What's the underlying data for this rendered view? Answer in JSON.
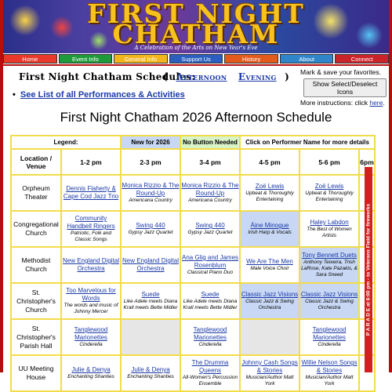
{
  "header": {
    "title_line1": "FIRST NIGHT",
    "title_line2": "CHATHAM",
    "tagline": "A Celebration of the Arts on New Year's Eve"
  },
  "nav": {
    "items": [
      {
        "label": "Home",
        "color": "#e8392b"
      },
      {
        "label": "Event Info",
        "color": "#1f9a3a"
      },
      {
        "label": "General Info",
        "color": "#f3b51c"
      },
      {
        "label": "Support Us",
        "color": "#2a5fbf"
      },
      {
        "label": "History",
        "color": "#e25a1c"
      },
      {
        "label": "About",
        "color": "#2f86c9"
      },
      {
        "label": "Connect",
        "color": "#c9242a"
      }
    ]
  },
  "schedules": {
    "label": "First Night Chatham Schedules:",
    "open_paren": "(",
    "afternoon": "Afternoon",
    "evening": "Evening",
    "close_paren": ")"
  },
  "see_list": "See List of all Performances & Activities",
  "favorites": {
    "text": "Mark & save your favorites.",
    "button": "Show Select/Deselect Icons",
    "more_prefix": "More instructions: click",
    "more_link": "here",
    "more_suffix": "."
  },
  "page_title": "First Night Chatham 2026 Afternoon Schedule",
  "legend": {
    "label": "Legend:",
    "new": "New for 2026",
    "no_button": "No Button Needed",
    "click_info": "Click on Performer Name for more details"
  },
  "columns": {
    "location": "Location / Venue",
    "t1": "1-2 pm",
    "t2": "2-3 pm",
    "t3": "3-4 pm",
    "t4": "4-5 pm",
    "t5": "5-6 pm",
    "t6": "6pm"
  },
  "parade": "P A R A D E   at 6:00 pm - to Veterans Field for fireworks",
  "rows": [
    {
      "venue": "Orpheum Theater",
      "cells": [
        {
          "perf": "Dennis Flaherty & Cape Cod Jazz Trio",
          "desc": ""
        },
        {
          "perf": "Monica Rizzio & The Round-Up",
          "desc": "Americana Country"
        },
        {
          "perf": "Monica Rizzio & The Round-Up",
          "desc": "Americana Country"
        },
        {
          "perf": "Zoë Lewis",
          "desc": "Upbeat & Thoroughly Entertaining"
        },
        {
          "perf": "Zoë Lewis",
          "desc": "Upbeat & Thoroughly Entertaining"
        }
      ]
    },
    {
      "venue": "Congregational Church",
      "cells": [
        {
          "perf": "Community Handbell Ringers",
          "desc": "Patriotic, Folk and Classic Songs"
        },
        {
          "perf": "Swing 440",
          "desc": "Gypsy Jazz Quartet"
        },
        {
          "perf": "Swing 440",
          "desc": "Gypsy Jazz Quartet"
        },
        {
          "perf": "Áine Minogue",
          "desc": "Irish Harp & Vocals",
          "new": true
        },
        {
          "perf": "Haley Labdon",
          "desc": "The Best of Women Artists"
        }
      ]
    },
    {
      "venue": "Methodist Church",
      "cells": [
        {
          "perf": "New England Digital Orchestra",
          "desc": ""
        },
        {
          "perf": "New England Digital Orchestra",
          "desc": ""
        },
        {
          "perf": "Ana Glig and James Rosenblum",
          "desc": "Classical Piano Duo"
        },
        {
          "perf": "We Are The Men",
          "desc": "Male Voice Choir"
        },
        {
          "perf": "Tony Bennett Duets",
          "desc": "Anthony Teixeira, Trish LaRose, Kate Pazakis, & Sara Sneed",
          "new": true
        }
      ]
    },
    {
      "venue": "St. Christopher's Church",
      "cells": [
        {
          "perf": "Too Marvelous for Words",
          "desc": "The words and music of Johnny Mercer"
        },
        {
          "perf": "Suede",
          "desc": "Like Adele meets Diana Krall meets Bette Midler"
        },
        {
          "perf": "Suede",
          "desc": "Like Adele meets Diana Krall meets Bette Midler"
        },
        {
          "perf": "Classic Jazz Visions",
          "desc": "Classic Jazz & Swing Orchestra",
          "new": true
        },
        {
          "perf": "Classic Jazz Visions",
          "desc": "Classic Jazz & Swing Orchestra",
          "new": true
        }
      ]
    },
    {
      "venue": "St. Christopher's Parish Hall",
      "cells": [
        {
          "perf": "Tanglewood Marionettes",
          "desc": "Cinderella"
        },
        {
          "perf": "",
          "desc": "",
          "blank": true
        },
        {
          "perf": "Tanglewood Marionettes",
          "desc": "Cinderella"
        },
        {
          "perf": "",
          "desc": "",
          "blank": true
        },
        {
          "perf": "Tanglewood Marionettes",
          "desc": "Cinderella"
        }
      ]
    },
    {
      "venue": "UU Meeting House",
      "cells": [
        {
          "perf": "Julie & Denya",
          "desc": "Enchanting Shanties"
        },
        {
          "perf": "Julie & Denya",
          "desc": "Enchanting Shanties"
        },
        {
          "perf": "The Drumma Queens",
          "desc": "All-Women's Percussion Ensemble"
        },
        {
          "perf": "Johnny Cash Songs & Stories",
          "desc": "Musician/Author Matt York"
        },
        {
          "perf": "Willie Nelson Songs & Stories",
          "desc": "Musician/Author Matt York"
        }
      ]
    }
  ]
}
